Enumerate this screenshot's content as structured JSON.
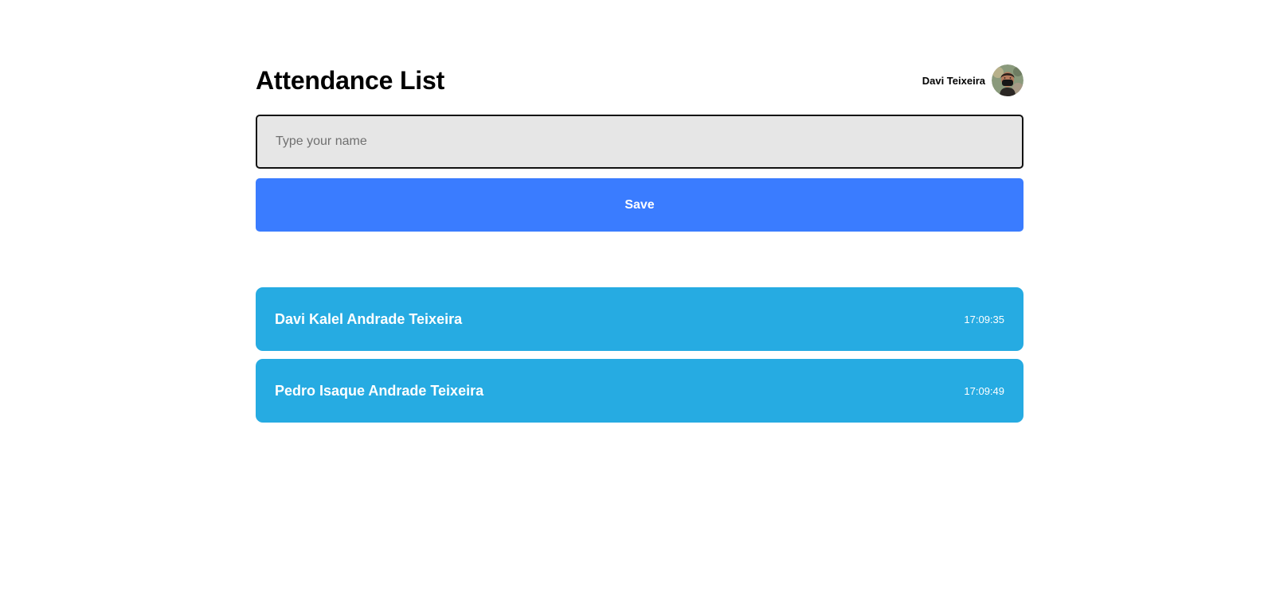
{
  "header": {
    "title": "Attendance List",
    "user": {
      "name": "Davi Teixeira",
      "avatar_icon": "user-avatar-icon"
    }
  },
  "form": {
    "name_placeholder": "Type your name",
    "name_value": "",
    "save_label": "Save"
  },
  "attendees": [
    {
      "name": "Davi Kalel Andrade Teixeira",
      "time": "17:09:35"
    },
    {
      "name": "Pedro Isaque Andrade Teixeira",
      "time": "17:09:49"
    }
  ],
  "colors": {
    "save_button": "#3a7cff",
    "card_background": "#26abe2",
    "input_background": "#e6e6e6",
    "input_border": "#111111"
  }
}
